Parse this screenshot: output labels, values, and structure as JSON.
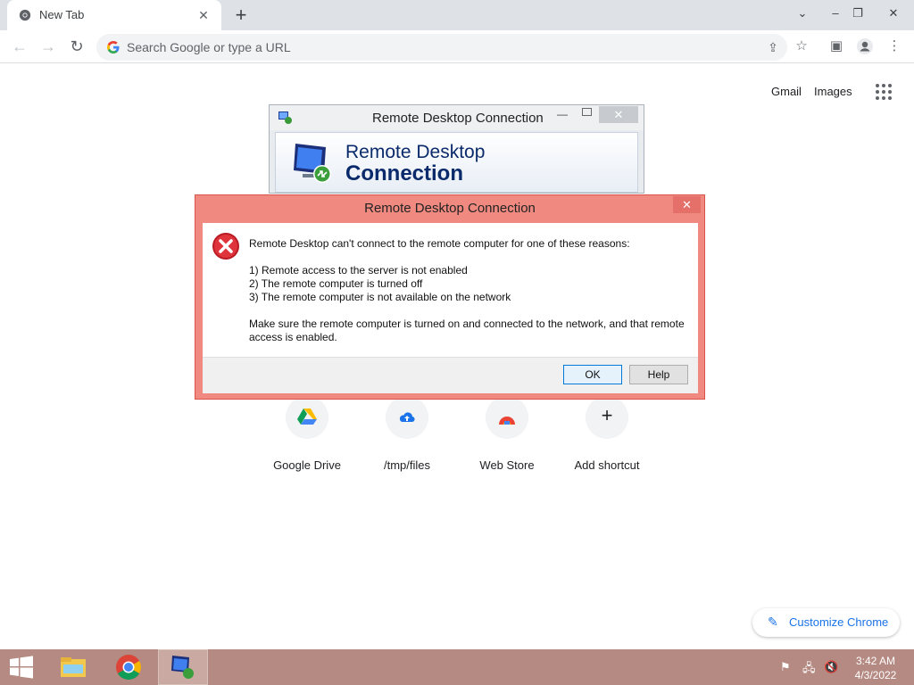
{
  "browser": {
    "tab_title": "New Tab",
    "omnibox_placeholder": "Search Google or type a URL",
    "icons": [
      "chrome-favicon",
      "tab-close-icon",
      "new-tab-icon",
      "chevron-down-icon",
      "minimize-icon",
      "restore-icon",
      "close-icon",
      "back-icon",
      "forward-icon",
      "reload-icon",
      "google-g-icon",
      "share-icon",
      "star-icon",
      "side-panel-icon",
      "profile-icon",
      "kebab-menu-icon"
    ]
  },
  "ntp": {
    "gmail": "Gmail",
    "images": "Images",
    "shortcuts": [
      {
        "label": "Google Drive",
        "icon": "google-drive-icon"
      },
      {
        "label": "/tmp/files",
        "icon": "cloud-upload-icon"
      },
      {
        "label": "Web Store",
        "icon": "web-store-icon"
      },
      {
        "label": "Add shortcut",
        "icon": "plus-icon"
      }
    ],
    "customize": "Customize Chrome"
  },
  "rdc_window": {
    "title": "Remote Desktop Connection",
    "banner_line1": "Remote Desktop",
    "banner_line2": "Connection"
  },
  "error_dialog": {
    "title": "Remote Desktop Connection",
    "lines": [
      "Remote Desktop can't connect to the remote computer for one of these reasons:",
      "1) Remote access to the server is not enabled",
      "2) The remote computer is turned off",
      "3) The remote computer is not available on the network",
      "Make sure the remote computer is turned on and connected to the network, and that remote",
      "access is enabled."
    ],
    "ok_label": "OK",
    "help_label": "Help"
  },
  "taskbar": {
    "time": "3:42 AM",
    "date": "4/3/2022",
    "colors": {
      "taskbar": "#b58a82",
      "dialog_title": "#f08a80"
    }
  }
}
